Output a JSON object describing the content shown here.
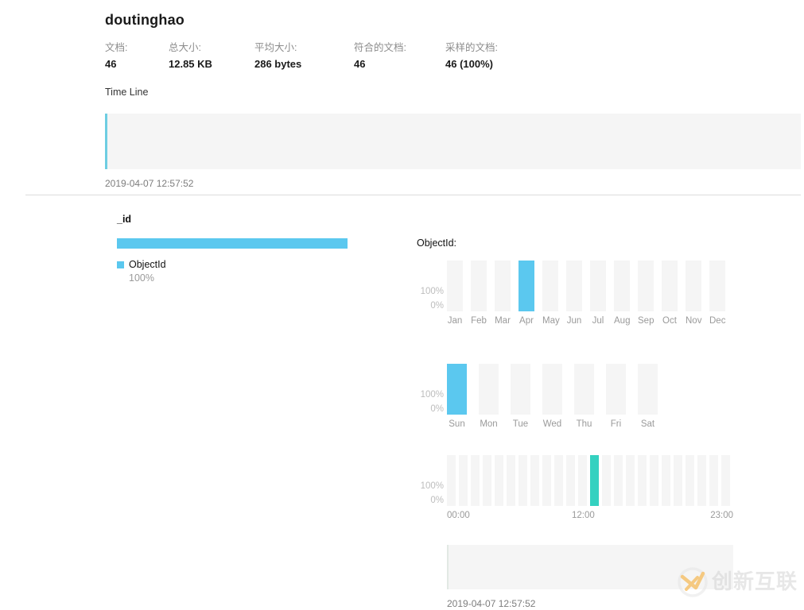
{
  "collection": {
    "title": "doutinghao"
  },
  "stats": [
    {
      "label": "文档:",
      "value": "46"
    },
    {
      "label": "总大小:",
      "value": "12.85 KB"
    },
    {
      "label": "平均大小:",
      "value": "286 bytes"
    },
    {
      "label": "符合的文档:",
      "value": "46"
    },
    {
      "label": "采样的文档:",
      "value": "46 (100%)"
    }
  ],
  "timeline": {
    "label": "Time Line",
    "date": "2019-04-07 12:57:52"
  },
  "field": {
    "name": "_id",
    "type_percent_width": "100%",
    "legend": {
      "type_name": "ObjectId",
      "percent": "100%",
      "color": "#5bc8ef"
    }
  },
  "charts_header": "ObjectId:",
  "detail": {
    "date": "2019-04-07 12:57:52"
  },
  "axis": {
    "top_label": "100%",
    "bottom_label": "0%"
  },
  "watermark": {
    "text": "创新互联",
    "logo_color": "#f5a623"
  },
  "chart_data": [
    {
      "type": "bar",
      "name": "month-distribution",
      "title": "ObjectId:",
      "categories": [
        "Jan",
        "Feb",
        "Mar",
        "Apr",
        "May",
        "Jun",
        "Jul",
        "Aug",
        "Sep",
        "Oct",
        "Nov",
        "Dec"
      ],
      "values": [
        0,
        0,
        0,
        100,
        0,
        0,
        0,
        0,
        0,
        0,
        0,
        0
      ],
      "ylim": [
        0,
        100
      ],
      "ytick_labels": [
        "0%",
        "100%"
      ],
      "ylabel": "",
      "xlabel": "",
      "grid": false,
      "bar_color": "#5bc8ef",
      "track_color": "#f5f5f5"
    },
    {
      "type": "bar",
      "name": "weekday-distribution",
      "title": "",
      "categories": [
        "Sun",
        "Mon",
        "Tue",
        "Wed",
        "Thu",
        "Fri",
        "Sat"
      ],
      "values": [
        100,
        0,
        0,
        0,
        0,
        0,
        0
      ],
      "ylim": [
        0,
        100
      ],
      "ytick_labels": [
        "0%",
        "100%"
      ],
      "ylabel": "",
      "xlabel": "",
      "grid": false,
      "bar_color": "#5bc8ef",
      "track_color": "#f5f5f5"
    },
    {
      "type": "bar",
      "name": "hour-distribution",
      "title": "",
      "categories": [
        "00",
        "01",
        "02",
        "03",
        "04",
        "05",
        "06",
        "07",
        "08",
        "09",
        "10",
        "11",
        "12",
        "13",
        "14",
        "15",
        "16",
        "17",
        "18",
        "19",
        "20",
        "21",
        "22",
        "23"
      ],
      "tick_labels": [
        "00:00",
        "12:00",
        "23:00"
      ],
      "values": [
        0,
        0,
        0,
        0,
        0,
        0,
        0,
        0,
        0,
        0,
        0,
        0,
        100,
        0,
        0,
        0,
        0,
        0,
        0,
        0,
        0,
        0,
        0,
        0
      ],
      "ylim": [
        0,
        100
      ],
      "ytick_labels": [
        "0%",
        "100%"
      ],
      "ylabel": "",
      "xlabel": "",
      "grid": false,
      "bar_color": "#34d1c0",
      "track_color": "#f5f5f5"
    }
  ]
}
